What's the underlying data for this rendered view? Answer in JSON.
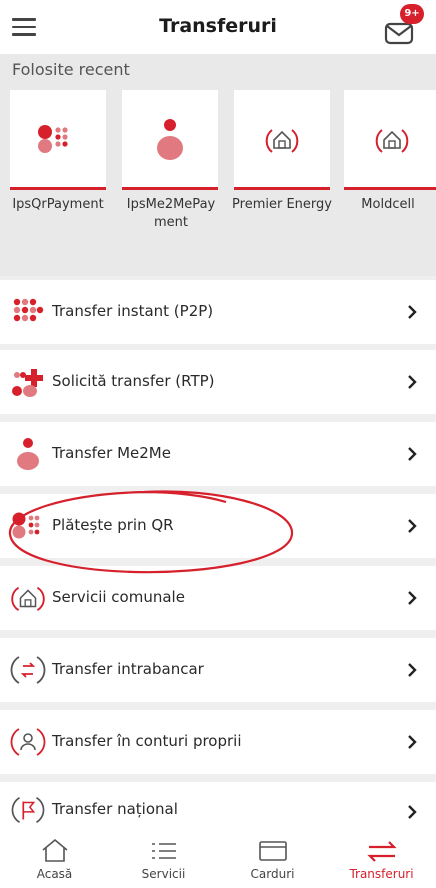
{
  "header": {
    "title": "Transferuri",
    "badge": "9+",
    "menu_icon": "hamburger-icon",
    "mail_icon": "mail-icon"
  },
  "recent": {
    "title": "Folosite recent",
    "items": [
      {
        "label": "IpsQrPayment",
        "icon": "qr-dots-icon"
      },
      {
        "label": "IpsMe2MePay ment",
        "icon": "me2me-person-icon"
      },
      {
        "label": "Premier Energy",
        "icon": "house-icon"
      },
      {
        "label": "Moldcell",
        "icon": "house-icon"
      }
    ]
  },
  "list": [
    {
      "label": "Transfer instant (P2P)",
      "icon": "dots-grid-icon"
    },
    {
      "label": "Solicită transfer (RTP)",
      "icon": "rtp-plus-icon"
    },
    {
      "label": "Transfer Me2Me",
      "icon": "me2me-person-icon"
    },
    {
      "label": "Plătește prin QR",
      "icon": "qr-dots-icon"
    },
    {
      "label": "Servicii comunale",
      "icon": "house-icon"
    },
    {
      "label": "Transfer intrabancar",
      "icon": "swap-arrows-icon"
    },
    {
      "label": "Transfer în conturi proprii",
      "icon": "own-accounts-icon"
    },
    {
      "label": "Transfer național",
      "icon": "flag-icon"
    }
  ],
  "tabs": [
    {
      "label": "Acasă",
      "icon": "home-icon"
    },
    {
      "label": "Servicii",
      "icon": "list-icon"
    },
    {
      "label": "Carduri",
      "icon": "card-icon"
    },
    {
      "label": "Transferuri",
      "icon": "transfer-arrows-icon"
    }
  ],
  "colors": {
    "accent": "#d6202c",
    "accent_light": "#e07a80",
    "background": "#efefef"
  }
}
